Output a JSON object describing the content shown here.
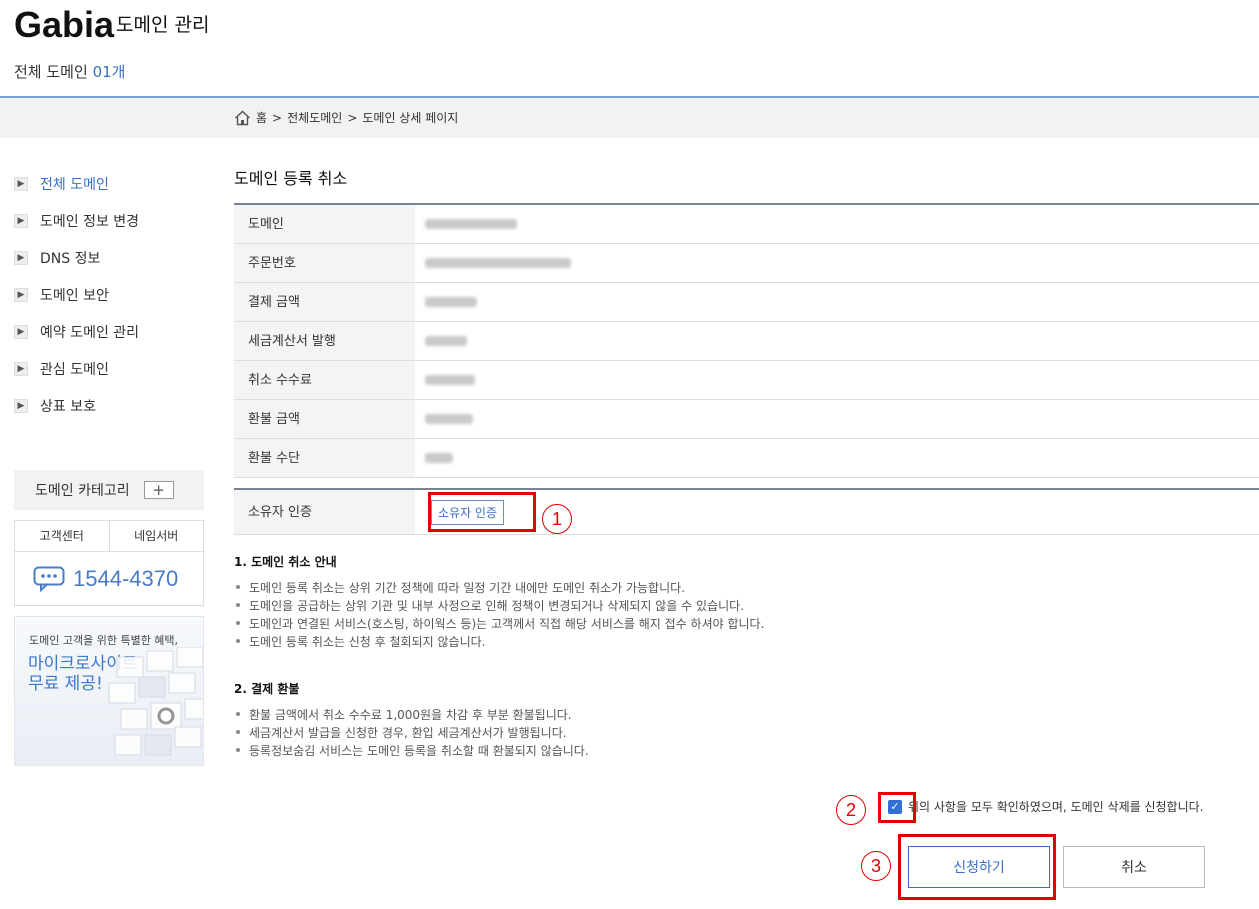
{
  "header": {
    "logo": "Gabia",
    "subtitle": "도메인 관리",
    "count_label": "전체 도메인",
    "count_value": "01개"
  },
  "breadcrumb": {
    "home": "홈",
    "sep1": ">",
    "level1": "전체도메인",
    "sep2": ">",
    "level2": "도메인 상세 페이지"
  },
  "sidebar": {
    "items": [
      {
        "label": "전체 도메인",
        "active": true
      },
      {
        "label": "도메인 정보 변경"
      },
      {
        "label": "DNS 정보"
      },
      {
        "label": "도메인 보안"
      },
      {
        "label": "예약 도메인 관리"
      },
      {
        "label": "관심 도메인"
      },
      {
        "label": "상표 보호"
      }
    ],
    "category_label": "도메인 카테고리",
    "category_add": "+",
    "cs_tab1": "고객센터",
    "cs_tab2": "네임서버",
    "phone": "1544-4370",
    "promo_small": "도메인 고객을 위한 특별한 혜택,",
    "promo_big_1": "마이크로사이트",
    "promo_big_2": "무료 제공!"
  },
  "main": {
    "title": "도메인 등록 취소",
    "rows": [
      {
        "label": "도메인"
      },
      {
        "label": "주문번호"
      },
      {
        "label": "결제 금액"
      },
      {
        "label": "세금계산서 발행"
      },
      {
        "label": "취소 수수료"
      },
      {
        "label": "환불 금액"
      },
      {
        "label": "환불 수단"
      }
    ],
    "owner_label": "소유자 인증",
    "owner_button": "소유자 인증",
    "markers": [
      "1",
      "2",
      "3"
    ],
    "notice1": {
      "title": "1. 도메인 취소 안내",
      "items": [
        "도메인 등록 취소는 상위 기간 정책에 따라 일정 기간 내에만 도메인 취소가 가능합니다.",
        "도메인을 공급하는 상위 기관 및 내부 사정으로 인해 정책이 변경되거나 삭제되지 않을 수 있습니다.",
        "도메인과 연결된 서비스(호스팅, 하이웍스 등)는 고객께서 직접 해당 서비스를 해지 접수 하셔야 합니다.",
        "도메인 등록 취소는 신청 후 철회되지 않습니다."
      ]
    },
    "notice2": {
      "title": "2. 결제 환불",
      "items": [
        "환불 금액에서 취소 수수료 1,000원을 차감 후 부분 환불됩니다.",
        "세금계산서 발급을 신청한 경우, 환입 세금계산서가 발행됩니다.",
        "등록정보숨김 서비스는 도메인 등록을 취소할 때 환불되지 않습니다."
      ]
    },
    "agree_text": "위의 사항을 모두 확인하였으며, 도메인 삭제를 신청합니다.",
    "submit_label": "신청하기",
    "cancel_label": "취소"
  },
  "colors": {
    "accent": "#3a6fc4",
    "highlight": "#e50000"
  }
}
